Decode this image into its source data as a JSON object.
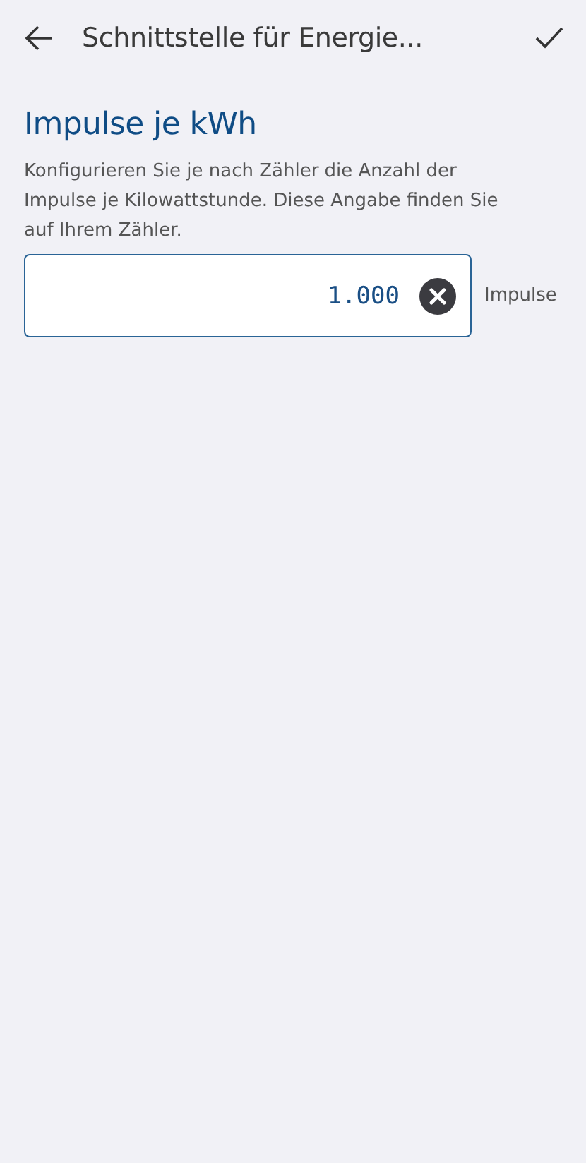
{
  "header": {
    "title": "Schnittstelle für Energie..."
  },
  "section": {
    "heading": "Impulse je kWh",
    "description": "Konfigurieren Sie je nach Zähler die Anzahl der Impulse je Kilowattstunde. Diese Angabe finden Sie auf Ihrem Zähler."
  },
  "field": {
    "value": "1.000",
    "unit": "Impulse"
  }
}
